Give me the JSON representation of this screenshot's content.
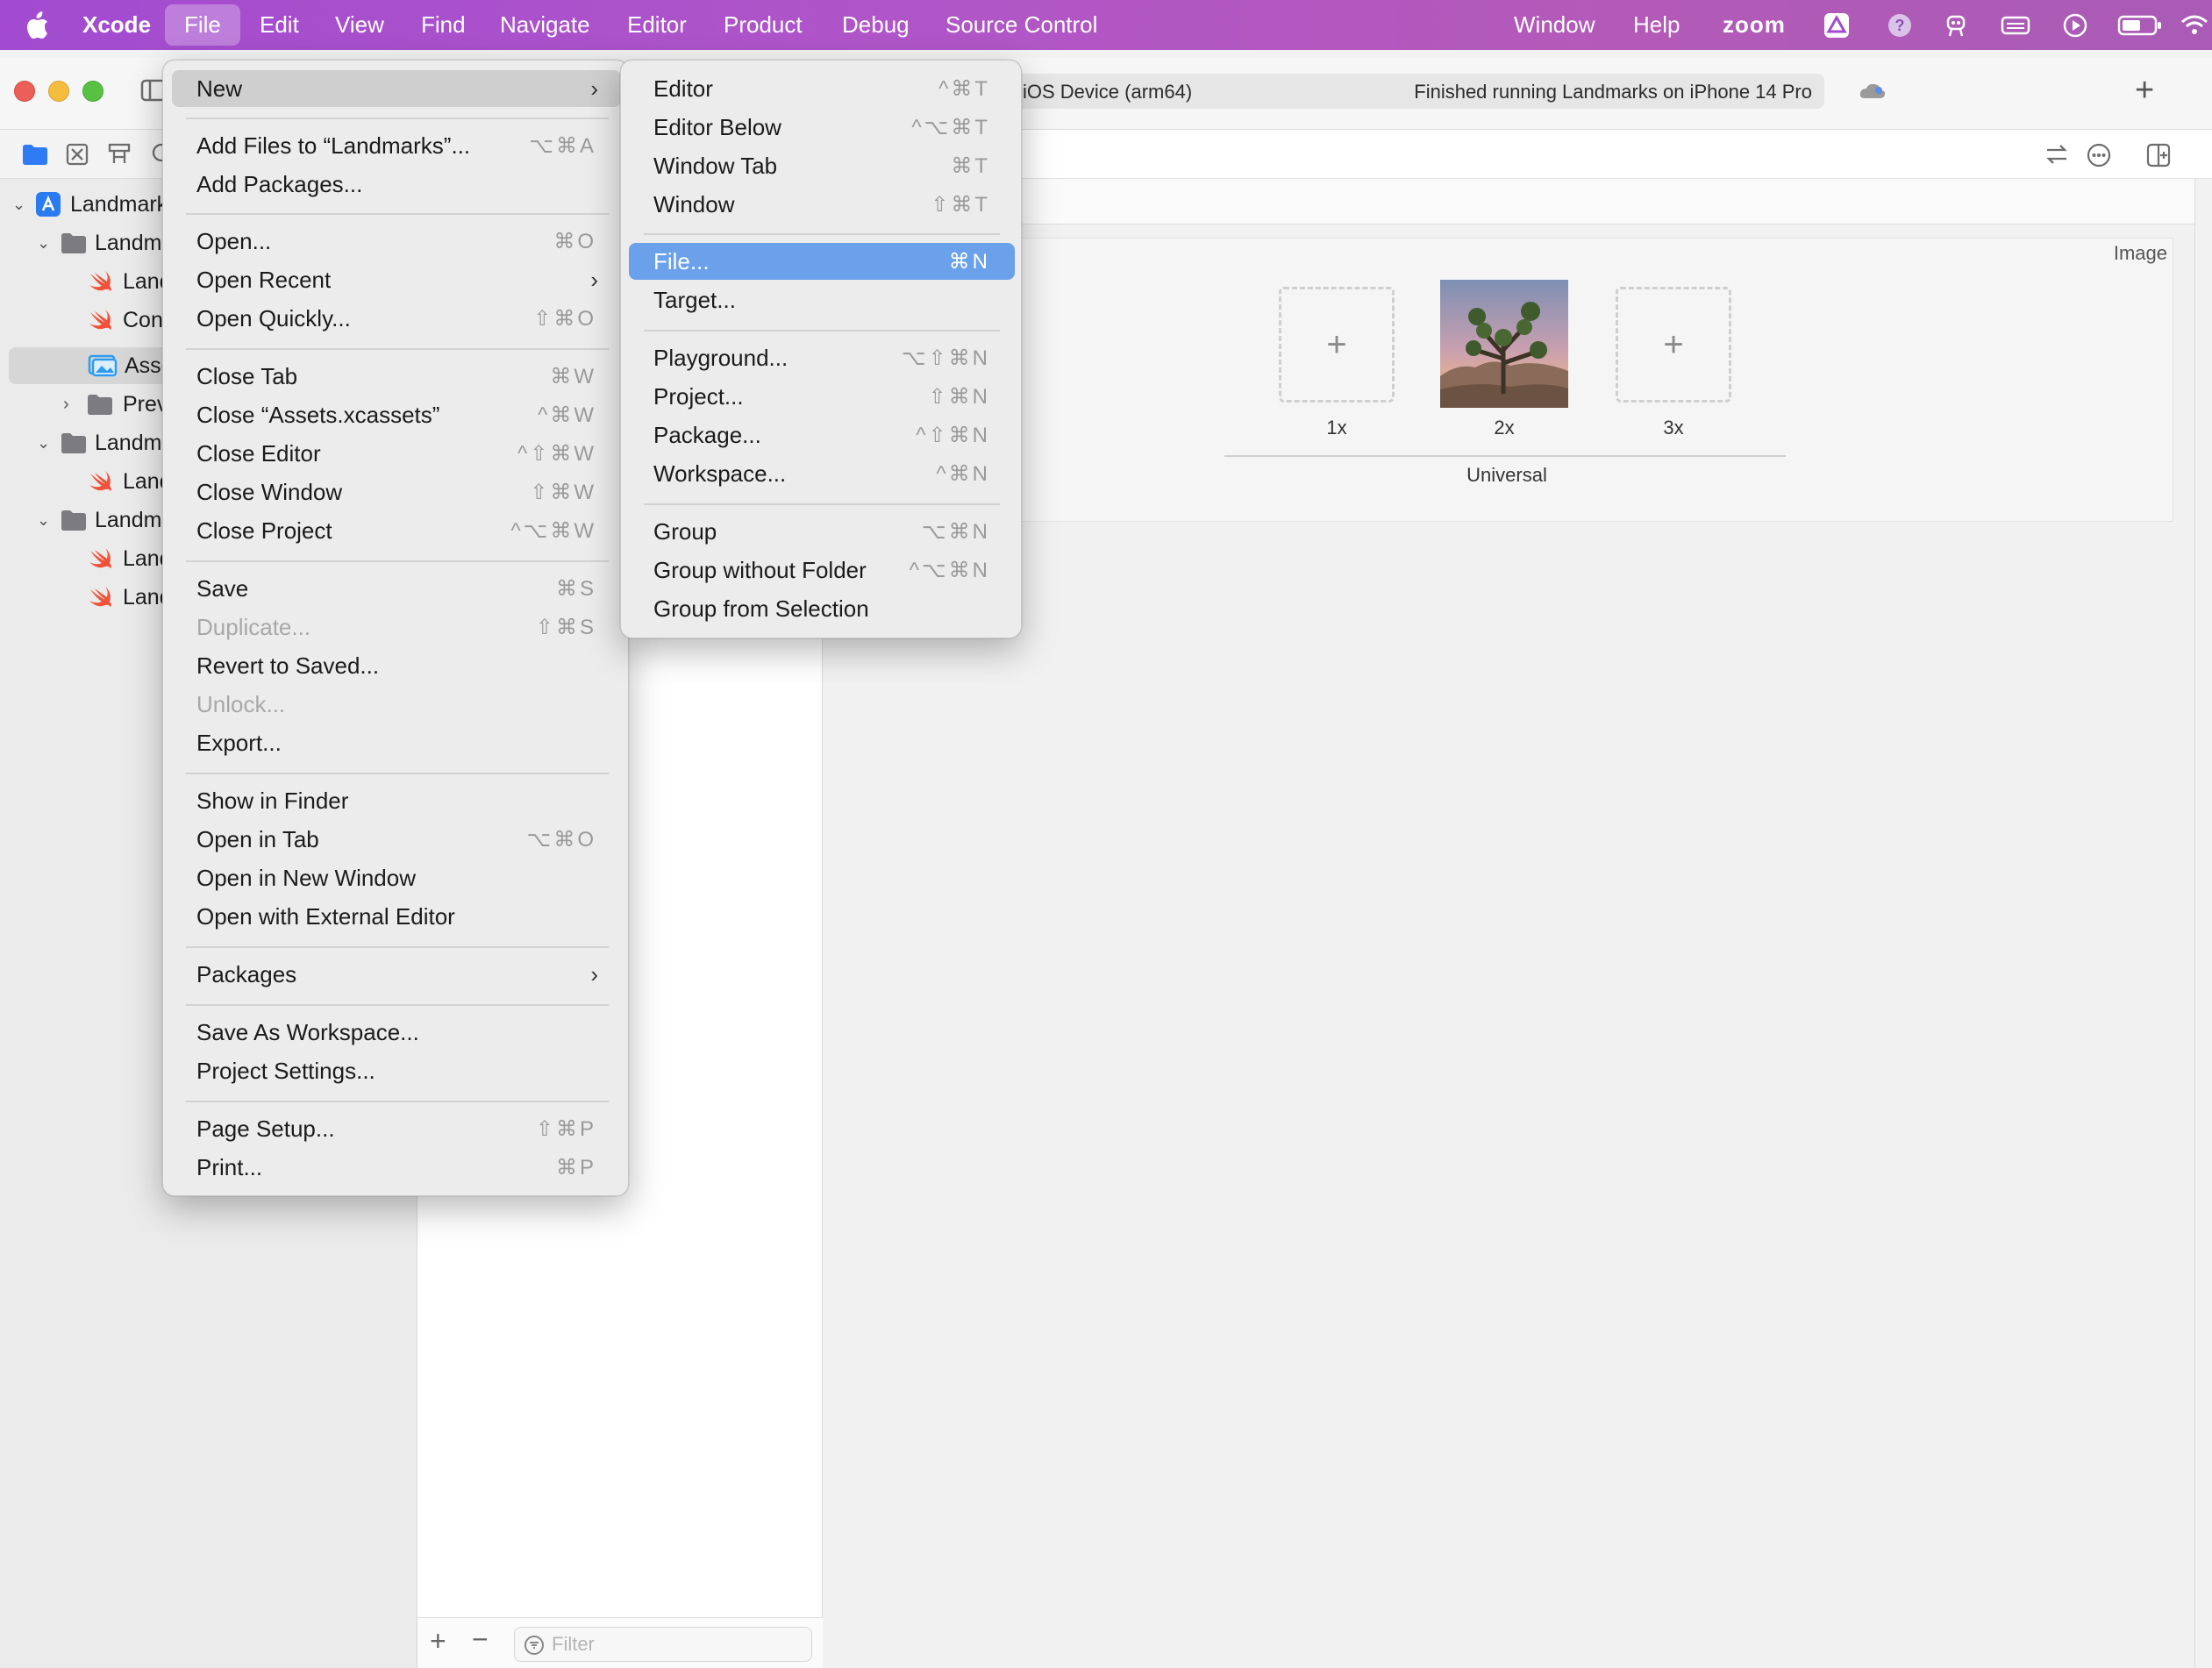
{
  "menubar": {
    "app": "Xcode",
    "items": [
      "File",
      "Edit",
      "View",
      "Find",
      "Navigate",
      "Editor",
      "Product",
      "Debug",
      "Source Control"
    ],
    "right_items": [
      "Window",
      "Help",
      "zoom"
    ]
  },
  "toolbar": {
    "scheme_destination": "iOS Device (arm64)",
    "status": "Finished running Landmarks on iPhone 14 Pro"
  },
  "navigator": {
    "items": [
      "Landmarks",
      "Landmarks",
      "Landmarks",
      "Content",
      "Assets",
      "Preview",
      "Landmarks",
      "Landmarks",
      "Landmarks",
      "Landmarks",
      "Landmarks"
    ]
  },
  "editor": {
    "image_set_type": "Image",
    "slots": [
      "1x",
      "2x",
      "3x"
    ],
    "device": "Universal"
  },
  "filter_placeholder": "Filter",
  "file_menu": [
    {
      "label": "New",
      "submenu": true,
      "state": "open"
    },
    {
      "label": "Add Files to “Landmarks”...",
      "shortcut": "⌥⌘A"
    },
    {
      "label": "Add Packages..."
    },
    {
      "label": "Open...",
      "shortcut": "⌘O"
    },
    {
      "label": "Open Recent",
      "submenu": true
    },
    {
      "label": "Open Quickly...",
      "shortcut": "⇧⌘O"
    },
    {
      "label": "Close Tab",
      "shortcut": "⌘W"
    },
    {
      "label": "Close “Assets.xcassets”",
      "shortcut": "^⌘W"
    },
    {
      "label": "Close Editor",
      "shortcut": "^⇧⌘W"
    },
    {
      "label": "Close Window",
      "shortcut": "⇧⌘W"
    },
    {
      "label": "Close Project",
      "shortcut": "^⌥⌘W"
    },
    {
      "label": "Save",
      "shortcut": "⌘S"
    },
    {
      "label": "Duplicate...",
      "shortcut": "⇧⌘S",
      "disabled": true
    },
    {
      "label": "Revert to Saved..."
    },
    {
      "label": "Unlock...",
      "disabled": true
    },
    {
      "label": "Export..."
    },
    {
      "label": "Show in Finder"
    },
    {
      "label": "Open in Tab",
      "shortcut": "⌥⌘O"
    },
    {
      "label": "Open in New Window"
    },
    {
      "label": "Open with External Editor"
    },
    {
      "label": "Packages",
      "submenu": true
    },
    {
      "label": "Save As Workspace..."
    },
    {
      "label": "Project Settings..."
    },
    {
      "label": "Page Setup...",
      "shortcut": "⇧⌘P"
    },
    {
      "label": "Print...",
      "shortcut": "⌘P"
    }
  ],
  "new_submenu": [
    {
      "label": "Editor",
      "shortcut": "^⌘T"
    },
    {
      "label": "Editor Below",
      "shortcut": "^⌥⌘T"
    },
    {
      "label": "Window Tab",
      "shortcut": "⌘T"
    },
    {
      "label": "Window",
      "shortcut": "⇧⌘T"
    },
    {
      "label": "File...",
      "shortcut": "⌘N",
      "highlighted": true
    },
    {
      "label": "Target..."
    },
    {
      "label": "Playground...",
      "shortcut": "⌥⇧⌘N"
    },
    {
      "label": "Project...",
      "shortcut": "⇧⌘N"
    },
    {
      "label": "Package...",
      "shortcut": "^⇧⌘N"
    },
    {
      "label": "Workspace...",
      "shortcut": "^⌘N"
    },
    {
      "label": "Group",
      "shortcut": "⌥⌘N"
    },
    {
      "label": "Group without Folder",
      "shortcut": "^⌥⌘N"
    },
    {
      "label": "Group from Selection"
    }
  ],
  "colors": {
    "menubar": "#a24bd0",
    "highlight": "#6aa1ea",
    "swift": "#f05138",
    "folder": "#7b7b80"
  }
}
